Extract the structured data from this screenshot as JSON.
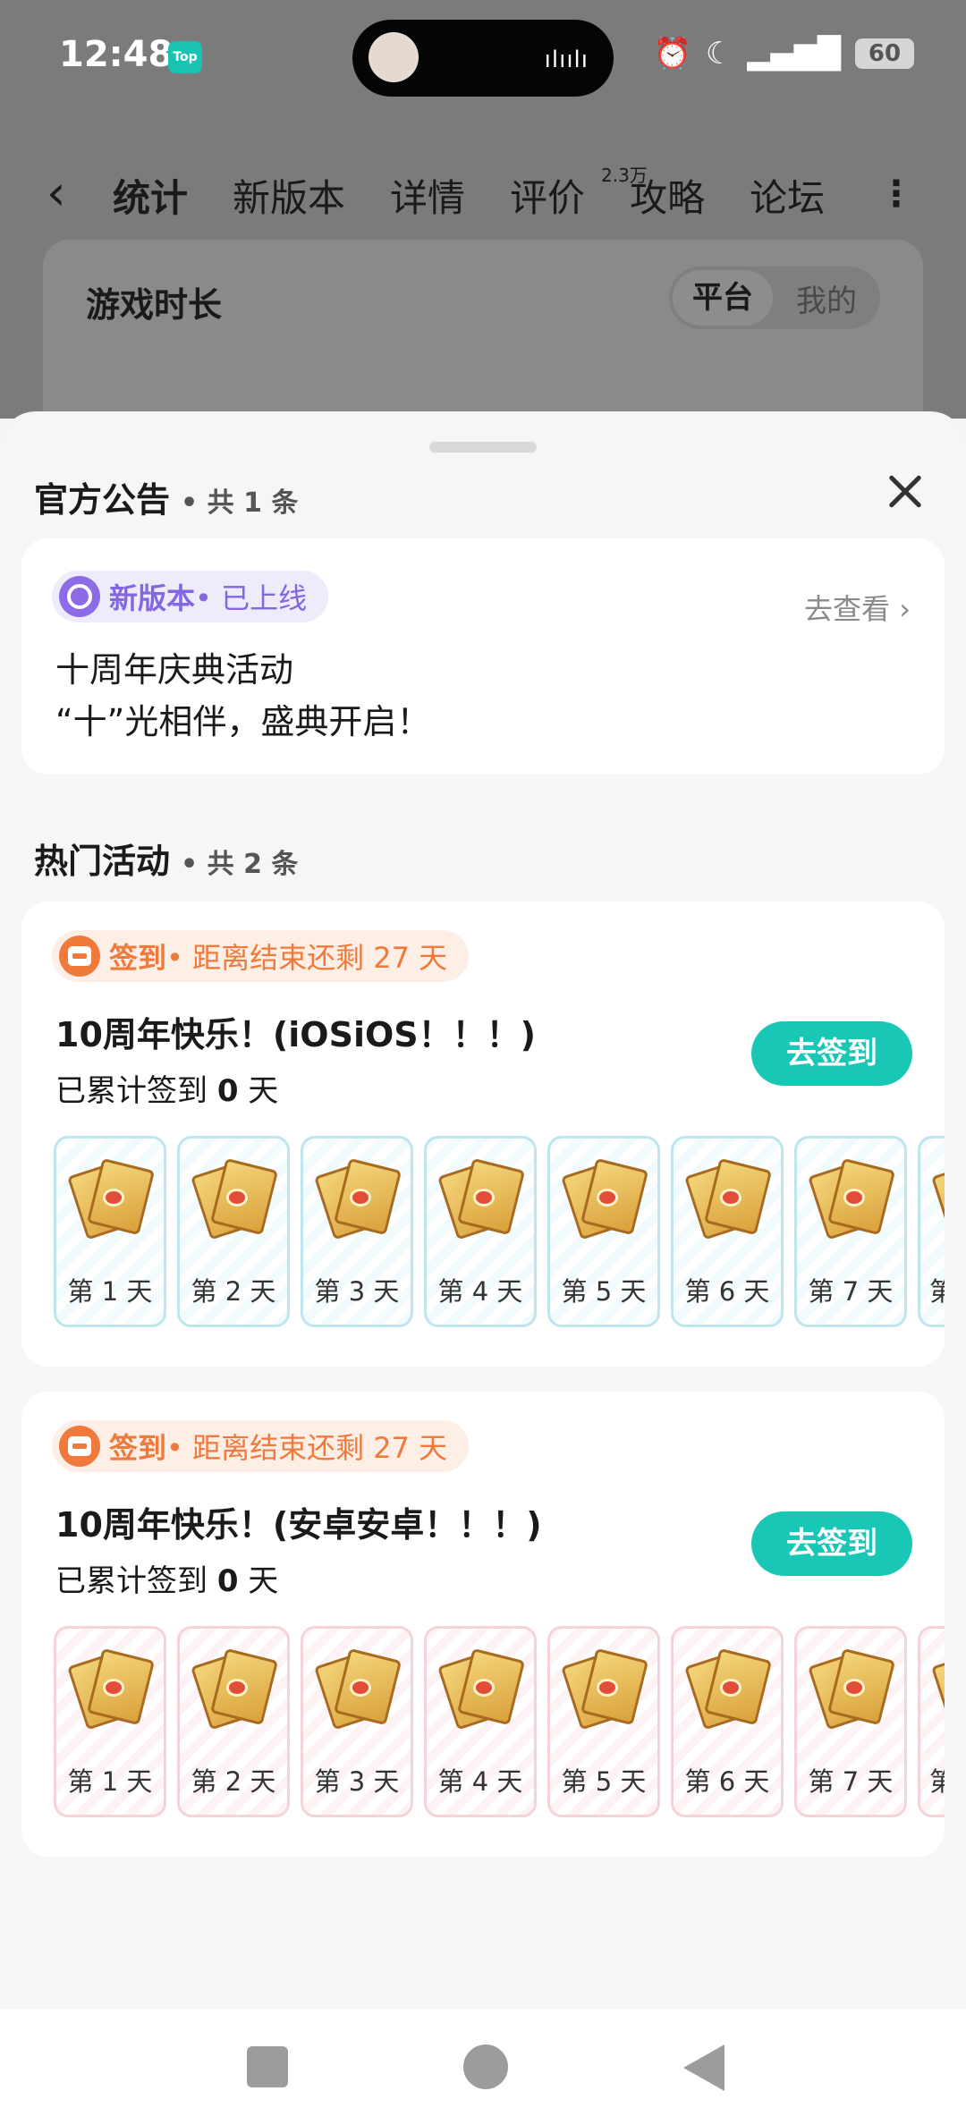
{
  "status_bar": {
    "time": "12:48",
    "app_badge": "Top",
    "battery": "60"
  },
  "header": {
    "tabs": [
      {
        "label": "统计"
      },
      {
        "label": "新版本"
      },
      {
        "label": "详情"
      },
      {
        "label": "评价"
      },
      {
        "label": "攻略"
      },
      {
        "label": "论坛"
      }
    ],
    "review_count": "2.3万"
  },
  "background_card": {
    "title": "游戏时长",
    "toggle_on": "平台",
    "toggle_off": "我的"
  },
  "announcements": {
    "title": "官方公告",
    "count": "• 共 1 条",
    "item": {
      "tag": "新版本",
      "status": "• 已上线",
      "link": "去查看 ›",
      "line1": "十周年庆典活动",
      "line2": "“十”光相伴，盛典开启！"
    }
  },
  "activities": {
    "title": "热门活动",
    "count": "• 共 2 条",
    "items": [
      {
        "tag": "签到",
        "remaining": "• 距离结束还剩 27 天",
        "name": "10周年快乐！(iOSiOS！！！)",
        "progress_prefix": "已累计签到",
        "progress_value": "0",
        "progress_suffix": "天",
        "button": "去签到",
        "days": [
          "第 1 天",
          "第 2 天",
          "第 3 天",
          "第 4 天",
          "第 5 天",
          "第 6 天",
          "第 7 天",
          "第"
        ]
      },
      {
        "tag": "签到",
        "remaining": "• 距离结束还剩 27 天",
        "name": "10周年快乐！(安卓安卓！！！)",
        "progress_prefix": "已累计签到",
        "progress_value": "0",
        "progress_suffix": "天",
        "button": "去签到",
        "days": [
          "第 1 天",
          "第 2 天",
          "第 3 天",
          "第 4 天",
          "第 5 天",
          "第 6 天",
          "第 7 天",
          "第"
        ]
      }
    ]
  },
  "colors": {
    "accent_teal": "#19c7b6",
    "signin_orange": "#ef7a3b",
    "version_purple": "#8466e0"
  }
}
